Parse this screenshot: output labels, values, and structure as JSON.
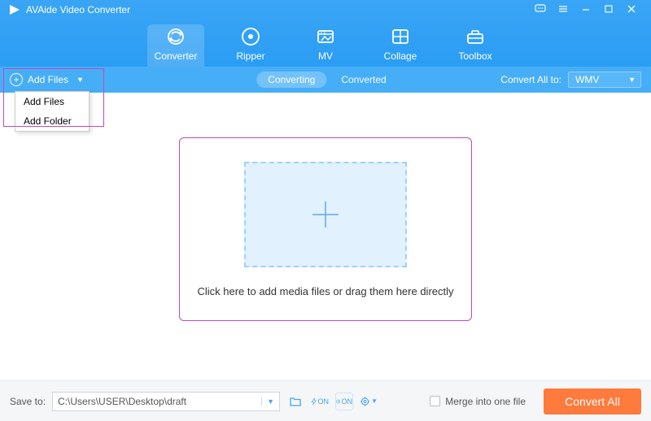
{
  "title": "AVAide Video Converter",
  "nav": {
    "items": [
      {
        "label": "Converter"
      },
      {
        "label": "Ripper"
      },
      {
        "label": "MV"
      },
      {
        "label": "Collage"
      },
      {
        "label": "Toolbox"
      }
    ]
  },
  "subbar": {
    "addfiles_label": "Add Files",
    "tab_converting": "Converting",
    "tab_converted": "Converted",
    "convert_all_label": "Convert All to:",
    "convert_all_value": "WMV"
  },
  "dropdown": {
    "item1": "Add Files",
    "item2": "Add Folder"
  },
  "dropzone": {
    "text": "Click here to add media files or drag them here directly"
  },
  "footer": {
    "saveto_label": "Save to:",
    "path": "C:\\Users\\USER\\Desktop\\draft",
    "merge_label": "Merge into one file",
    "convert_label": "Convert All"
  }
}
